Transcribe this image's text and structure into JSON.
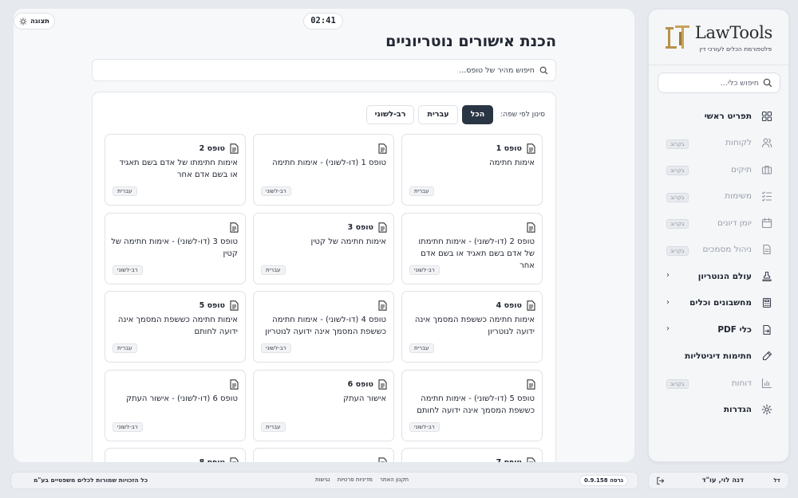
{
  "brand": {
    "name": "LawTools",
    "subtitle": "פלטפורמת הכלים לעורכי דין"
  },
  "sidebar": {
    "search_placeholder": "חיפוש כלי...",
    "soon_label": "בקרוב",
    "items": [
      {
        "label": "תפריט ראשי",
        "icon": "grid-icon",
        "state": "active"
      },
      {
        "label": "לקוחות",
        "icon": "users-icon",
        "state": "soon"
      },
      {
        "label": "תיקים",
        "icon": "briefcase-icon",
        "state": "soon"
      },
      {
        "label": "משימות",
        "icon": "checklist-icon",
        "state": "soon"
      },
      {
        "label": "יומן דיונים",
        "icon": "calendar-icon",
        "state": "soon"
      },
      {
        "label": "ניהול מסמכים",
        "icon": "document-icon",
        "state": "soon"
      },
      {
        "label": "עולם הנוטריון",
        "icon": "stamp-icon",
        "state": "expandable"
      },
      {
        "label": "מחשבונים וכלים",
        "icon": "calculator-icon",
        "state": "expandable"
      },
      {
        "label": "כלי PDF",
        "icon": "pdf-icon",
        "state": "expandable"
      },
      {
        "label": "חתימות דיגיטליות",
        "icon": "pen-icon",
        "state": "active"
      },
      {
        "label": "דוחות",
        "icon": "chart-icon",
        "state": "soon"
      },
      {
        "label": "הגדרות",
        "icon": "gear-icon",
        "state": "active"
      }
    ]
  },
  "user": {
    "initials": "דל",
    "name": "דנה לוי, עו\"ד"
  },
  "header": {
    "timer": "02:41",
    "display_label": "תצוגה",
    "title": "הכנת אישורים נוטריוניים"
  },
  "search": {
    "placeholder": "חיפוש מהיר של טופס..."
  },
  "filter": {
    "label": "סינון לפי שפה:",
    "options": [
      "הכל",
      "עברית",
      "רב-לשוני"
    ],
    "selected": "הכל"
  },
  "forms": [
    {
      "title": "טופס 1",
      "desc": "אימות חתימה",
      "lang": "עברית"
    },
    {
      "title": "",
      "desc": "טופס 1 (דו-לשוני) - אימות חתימה",
      "lang": "רב-לשוני"
    },
    {
      "title": "טופס 2",
      "desc": "אימות חתימתו של אדם בשם תאגיד או בשם אדם אחר",
      "lang": "עברית"
    },
    {
      "title": "",
      "desc": "טופס 2 (דו-לשוני) - אימות חתימתו של אדם בשם תאגיד או בשם אדם אחר",
      "lang": "רב-לשוני"
    },
    {
      "title": "טופס 3",
      "desc": "אימות חתימה של קטין",
      "lang": "עברית"
    },
    {
      "title": "",
      "desc": "טופס 3 (דו-לשוני) - אימות חתימה של קטין",
      "lang": "רב-לשוני"
    },
    {
      "title": "טופס 4",
      "desc": "אימות חתימה כששפת המסמך אינה ידועה לנוטריון",
      "lang": "עברית"
    },
    {
      "title": "",
      "desc": "טופס 4 (דו-לשוני) - אימות חתימה כששפת המסמך אינה ידועה לנוטריון",
      "lang": "רב-לשוני"
    },
    {
      "title": "טופס 5",
      "desc": "אימות חתימה כששפת המסמך אינה ידועה לחותם",
      "lang": "עברית"
    },
    {
      "title": "",
      "desc": "טופס 5 (דו-לשוני) - אימות חתימה כששפת המסמך אינה ידועה לחותם",
      "lang": "רב-לשוני"
    },
    {
      "title": "טופס 6",
      "desc": "אישור העתק",
      "lang": "עברית"
    },
    {
      "title": "",
      "desc": "טופס 6 (דו-לשוני) - אישור העתק",
      "lang": "רב-לשוני"
    }
  ],
  "partial_cards": [
    "טופס 7",
    "",
    "טופס 8"
  ],
  "footer": {
    "version": "גרסה 0.9.158",
    "links": [
      "תקנון האתר",
      "מדיניות פרטיות",
      "נגישות"
    ],
    "copyright": "כל הזכויות שמורות לכלים משפטיים בע\"מ"
  },
  "colors": {
    "accent": "#2a3544",
    "brand_gold": "#b8924a"
  }
}
